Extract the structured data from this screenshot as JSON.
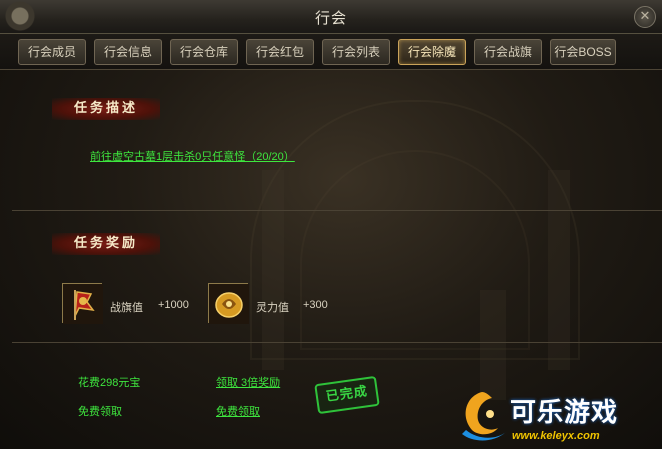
{
  "window": {
    "title": "行会"
  },
  "tabs": [
    {
      "label": "行会成员",
      "active": false
    },
    {
      "label": "行会信息",
      "active": false
    },
    {
      "label": "行会仓库",
      "active": false
    },
    {
      "label": "行会红包",
      "active": false
    },
    {
      "label": "行会列表",
      "active": false
    },
    {
      "label": "行会除魔",
      "active": true
    },
    {
      "label": "行会战旗",
      "active": false
    },
    {
      "label": "行会BOSS",
      "active": false
    }
  ],
  "task": {
    "section_title": "任务描述",
    "description": "前往虚空古墓1层击杀0只任意怪（20/20）"
  },
  "rewards": {
    "section_title": "任务奖励",
    "items": [
      {
        "icon": "war-flag-icon",
        "label": "战旗值",
        "value": "+1000"
      },
      {
        "icon": "spirit-power-icon",
        "label": "灵力值",
        "value": "+300"
      }
    ]
  },
  "claim": {
    "cost_label": "花费298元宝",
    "triple_link": "领取 3倍奖励",
    "free_label": "免费领取",
    "free_link": "免费领取",
    "completed_stamp": "已完成"
  },
  "watermark": {
    "brand": "可乐游戏",
    "url": "www.keleyx.com"
  },
  "colors": {
    "accent_green": "#3ee63e",
    "tab_active_border": "#caa35a",
    "section_title_bg": "#7a1c14"
  }
}
